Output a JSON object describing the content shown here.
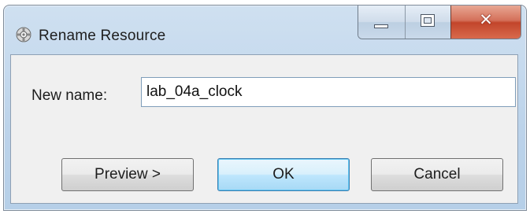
{
  "window": {
    "title": "Rename Resource",
    "icon": "gear-icon"
  },
  "caption_buttons": {
    "minimize": "minimize-icon",
    "maximize": "maximize-icon",
    "close": "close-icon"
  },
  "form": {
    "name_label": "New name:",
    "name_value": "lab_04a_clock"
  },
  "buttons": {
    "preview_label": "Preview >",
    "ok_label": "OK",
    "cancel_label": "Cancel"
  },
  "colors": {
    "title_bar": "#c6daee",
    "close_button": "#c2452b",
    "default_button_border": "#3c7fb1"
  }
}
